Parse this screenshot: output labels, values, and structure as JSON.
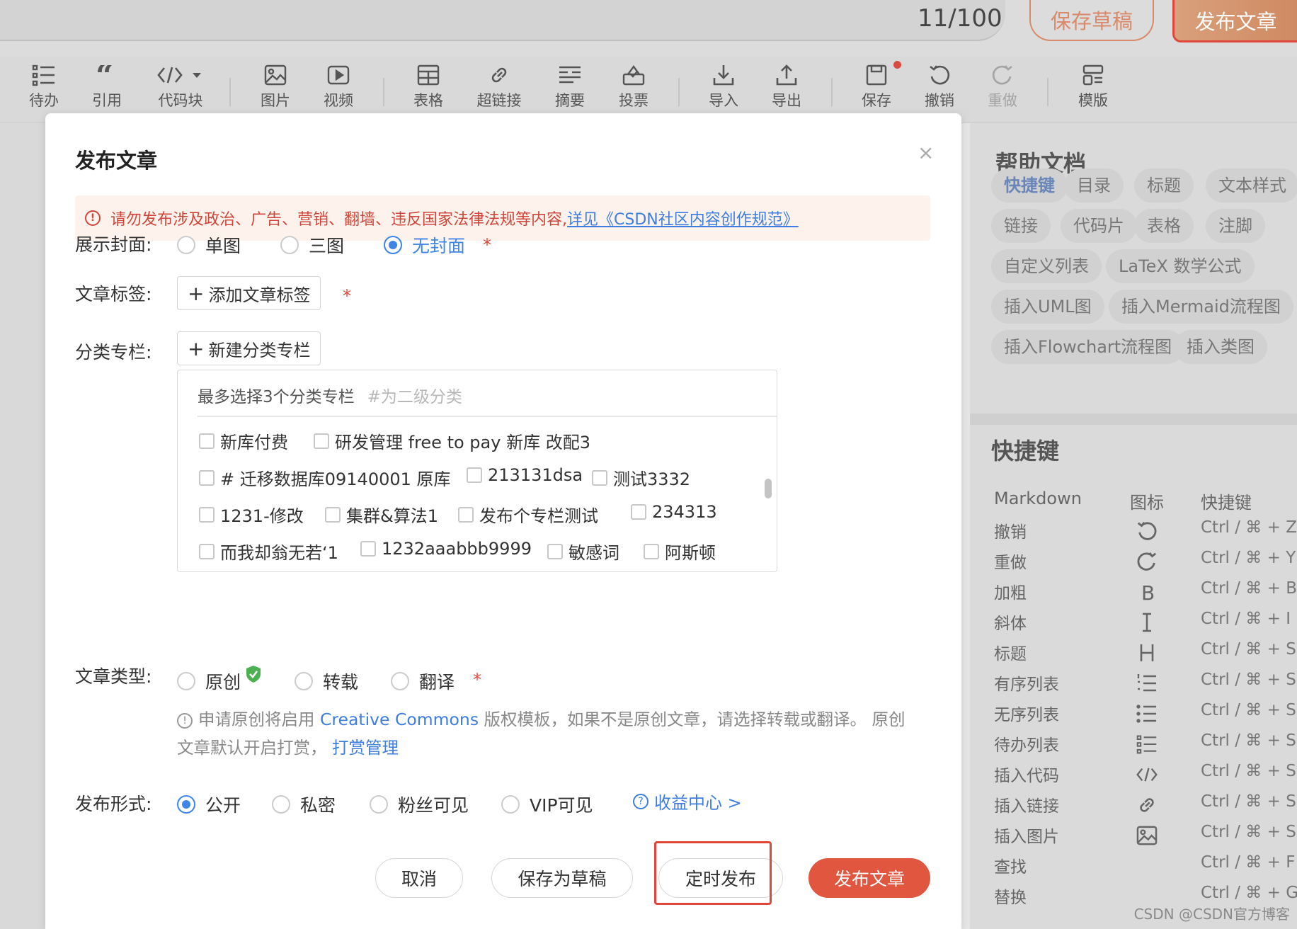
{
  "topbar": {
    "counter": "11/100",
    "save_draft": "保存草稿",
    "publish": "发布文章"
  },
  "toolbar": [
    {
      "label": "待办",
      "icon": "todo-list-icon",
      "disabled": false
    },
    {
      "label": "引用",
      "icon": "quote-icon",
      "disabled": false
    },
    {
      "label": "代码块",
      "icon": "code-block-icon",
      "disabled": false
    },
    {
      "label": "图片",
      "icon": "image-icon",
      "disabled": false
    },
    {
      "label": "视频",
      "icon": "video-icon",
      "disabled": false
    },
    {
      "label": "表格",
      "icon": "table-icon",
      "disabled": false
    },
    {
      "label": "超链接",
      "icon": "link-icon",
      "disabled": false
    },
    {
      "label": "摘要",
      "icon": "summary-icon",
      "disabled": false
    },
    {
      "label": "投票",
      "icon": "vote-icon",
      "disabled": false
    },
    {
      "label": "导入",
      "icon": "import-icon",
      "disabled": false
    },
    {
      "label": "导出",
      "icon": "export-icon",
      "disabled": false
    },
    {
      "label": "保存",
      "icon": "save-icon",
      "disabled": false
    },
    {
      "label": "撤销",
      "icon": "undo-icon",
      "disabled": false
    },
    {
      "label": "重做",
      "icon": "redo-icon",
      "disabled": true
    },
    {
      "label": "模版",
      "icon": "template-icon",
      "disabled": false
    }
  ],
  "modal": {
    "title": "发布文章",
    "close_icon": "×",
    "notice_text": "请勿发布涉及政治、广告、营销、翻墙、违反国家法律法规等内容,",
    "notice_link": "详见《CSDN社区内容创作规范》",
    "cover": {
      "label": "展示封面:",
      "options": [
        "单图",
        "三图",
        "无封面"
      ],
      "selected": "无封面"
    },
    "tags": {
      "label": "文章标签:",
      "button": "添加文章标签"
    },
    "category": {
      "label": "分类专栏:",
      "button": "新建分类专栏",
      "hint": "最多选择3个分类专栏",
      "hint_sub": "#为二级分类",
      "items": [
        [
          "新库付费",
          "研发管理 free to pay 新库 改配3"
        ],
        [
          "# 迁移数据库09140001 原库",
          "213131dsa",
          "测试3332"
        ],
        [
          "1231-修改",
          "集群&算法1",
          "发布个专栏测试",
          "234313"
        ],
        [
          "而我却翁无若‘1",
          "1232aaabbb9999",
          "敏感词",
          "阿斯顿"
        ]
      ]
    },
    "type": {
      "label": "文章类型:",
      "options": [
        "原创",
        "转载",
        "翻译"
      ],
      "info_pre": "申请原创将启用",
      "info_link1": "Creative Commons",
      "info_mid": "版权模板，如果不是原创文章，请选择转载或翻译。 原创文章默认开启打赏，",
      "info_link2": "打赏管理"
    },
    "visibility": {
      "label": "发布形式:",
      "options": [
        "公开",
        "私密",
        "粉丝可见",
        "VIP可见"
      ],
      "selected": "公开",
      "income_link": "收益中心 >"
    },
    "footer": {
      "cancel": "取消",
      "save_draft": "保存为草稿",
      "schedule": "定时发布",
      "publish": "发布文章"
    }
  },
  "help": {
    "title": "帮助文档",
    "pills": [
      "快捷键",
      "目录",
      "标题",
      "文本样式",
      "链接",
      "代码片",
      "表格",
      "注脚",
      "自定义列表",
      "LaTeX 数学公式",
      "插入UML图",
      "插入Mermaid流程图",
      "插入Flowchart流程图",
      "插入类图"
    ],
    "shortcuts_title": "快捷键",
    "col_markdown": "Markdown",
    "col_icon": "图标",
    "col_key": "快捷键",
    "rows": [
      {
        "name": "撤销",
        "icon": "undo-icon",
        "key": "Ctrl / ⌘ + Z"
      },
      {
        "name": "重做",
        "icon": "redo-icon",
        "key": "Ctrl / ⌘ + Y"
      },
      {
        "name": "加粗",
        "icon": "bold-icon",
        "key": "Ctrl / ⌘ + B"
      },
      {
        "name": "斜体",
        "icon": "italic-icon",
        "key": "Ctrl / ⌘ + I"
      },
      {
        "name": "标题",
        "icon": "heading-icon",
        "key": "Ctrl / ⌘ + Sh"
      },
      {
        "name": "有序列表",
        "icon": "ordered-list-icon",
        "key": "Ctrl / ⌘ + Sh"
      },
      {
        "name": "无序列表",
        "icon": "unordered-list-icon",
        "key": "Ctrl / ⌘ + Sh"
      },
      {
        "name": "待办列表",
        "icon": "todo-list-icon",
        "key": "Ctrl / ⌘ + Sh"
      },
      {
        "name": "插入代码",
        "icon": "code-icon",
        "key": "Ctrl / ⌘ + Sh"
      },
      {
        "name": "插入链接",
        "icon": "link-icon",
        "key": "Ctrl / ⌘ + Sh"
      },
      {
        "name": "插入图片",
        "icon": "image-icon",
        "key": "Ctrl / ⌘ + Sh"
      },
      {
        "name": "查找",
        "icon": "",
        "key": "Ctrl / ⌘ + F"
      },
      {
        "name": "替换",
        "icon": "",
        "key": "Ctrl / ⌘ + G"
      }
    ]
  },
  "watermark": "CSDN @CSDN官方博客"
}
